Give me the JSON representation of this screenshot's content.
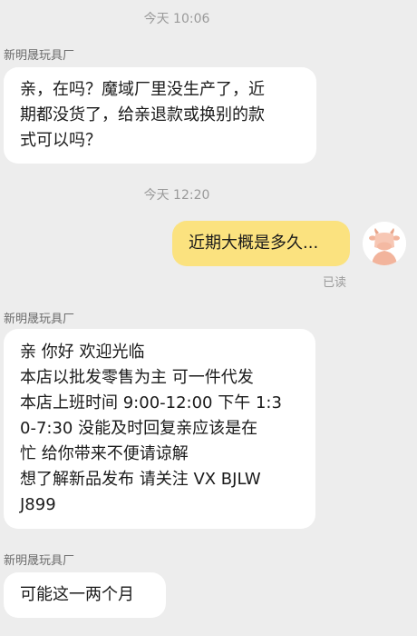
{
  "messages": {
    "ts1": "今天 10:06",
    "sender1": "新明晟玩具厂",
    "msg1": {
      "lines": [
        "亲，在吗？魔域厂里没生产了，近",
        "期都没货了，给亲退款或换别的款",
        "式可以吗？"
      ]
    },
    "ts2": "今天 12:20",
    "self_msg": "近期大概是多久...",
    "read_status": "已读",
    "sender2": "新明晟玩具厂",
    "msg2": {
      "lines": [
        "亲 你好 欢迎光临",
        "本店以批发零售为主 可一件代发",
        "本店上班时间 9:00-12:00 下午 1:3",
        "0-7:30 没能及时回复亲应该是在",
        "忙 给你带来不便请谅解",
        "想了解新品发布 请关注 VX   BJLW",
        "J899"
      ]
    },
    "sender3": "新明晟玩具厂",
    "msg3": "可能这一两个月"
  },
  "avatar_icon": "cow-avatar-icon",
  "colors": {
    "background": "#ededed",
    "self_bubble": "#fbe27f",
    "other_bubble": "#ffffff"
  }
}
